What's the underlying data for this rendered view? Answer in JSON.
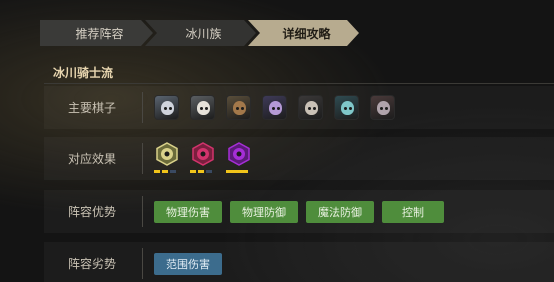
{
  "tabs": [
    "推荐阵容",
    "冰川族",
    "详细攻略"
  ],
  "active_tab_index": 2,
  "section": {
    "title": "冰川骑士流"
  },
  "rows": {
    "pieces": {
      "label": "主要棋子"
    },
    "synergy": {
      "label": "对应效果"
    },
    "strength": {
      "label": "阵容优势",
      "tags": [
        "物理伤害",
        "物理防御",
        "魔法防御",
        "控制"
      ]
    },
    "weakness": {
      "label": "阵容劣势",
      "tags": [
        "范围伤害"
      ]
    }
  },
  "pieces": [
    {
      "icon": "pale-ghost-hero-icon",
      "bg": "#5a6470",
      "face": "#cfd3dc"
    },
    {
      "icon": "white-hooded-hero-icon",
      "bg": "#5b5f62",
      "face": "#e6e2da"
    },
    {
      "icon": "tree-ent-hero-icon",
      "bg": "#5a4e3a",
      "face": "#a3784a"
    },
    {
      "icon": "purple-horned-hero-icon",
      "bg": "#3e3a58",
      "face": "#b59ad6"
    },
    {
      "icon": "dark-knight-hero-icon",
      "bg": "#3a3838",
      "face": "#c9c1b6"
    },
    {
      "icon": "teal-masked-hero-icon",
      "bg": "#2f4c52",
      "face": "#7fc7c9"
    },
    {
      "icon": "red-beast-hero-icon",
      "bg": "#4a3a3a",
      "face": "#b0a3ab"
    }
  ],
  "synergies": [
    {
      "icon": "glacier-badge-icon",
      "color": "#d9d18a",
      "ring": "#6b6b3a",
      "bars": [
        1,
        1,
        0
      ],
      "full": false
    },
    {
      "icon": "knight-badge-icon",
      "color": "#d2336c",
      "ring": "#7a1f3e",
      "bars": [
        1,
        1,
        0
      ],
      "full": false
    },
    {
      "icon": "demon-badge-icon",
      "color": "#a52ed6",
      "ring": "#5b1a78",
      "bars": [],
      "full": true
    }
  ]
}
